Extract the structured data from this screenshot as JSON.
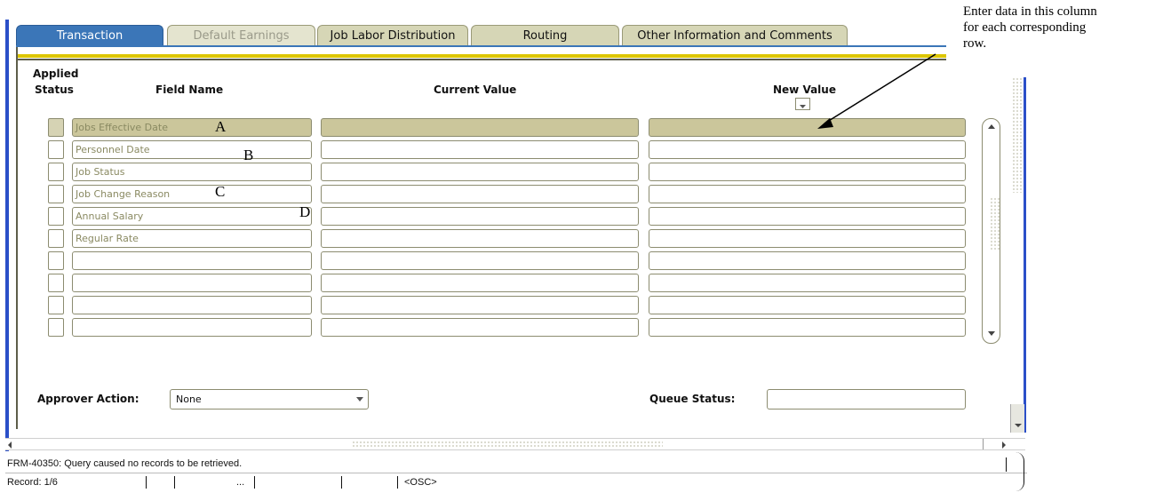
{
  "tabs": [
    {
      "label": "Transaction",
      "state": "active"
    },
    {
      "label": "Default Earnings",
      "state": "disabled"
    },
    {
      "label": "Job Labor Distribution",
      "state": "normal"
    },
    {
      "label": "Routing",
      "state": "normal"
    },
    {
      "label": "Other Information and Comments",
      "state": "normal"
    }
  ],
  "headers": {
    "applied_status_line1": "Applied",
    "applied_status_line2": "Status",
    "field_name": "Field Name",
    "current_value": "Current Value",
    "new_value": "New Value"
  },
  "rows": [
    {
      "field": "Jobs Effective Date",
      "current": "",
      "new": ""
    },
    {
      "field": "Personnel Date",
      "current": "",
      "new": ""
    },
    {
      "field": "Job Status",
      "current": "",
      "new": ""
    },
    {
      "field": "Job Change Reason",
      "current": "",
      "new": ""
    },
    {
      "field": "Annual Salary",
      "current": "",
      "new": ""
    },
    {
      "field": "Regular Rate",
      "current": "",
      "new": ""
    },
    {
      "field": "",
      "current": "",
      "new": ""
    },
    {
      "field": "",
      "current": "",
      "new": ""
    },
    {
      "field": "",
      "current": "",
      "new": ""
    },
    {
      "field": "",
      "current": "",
      "new": ""
    }
  ],
  "annotations": {
    "a": "A",
    "b": "B",
    "c": "C",
    "d": "D"
  },
  "note": {
    "line1": "Enter data  in this column",
    "line2": "for each corresponding",
    "line3": "row."
  },
  "approver": {
    "label": "Approver Action:",
    "value": "None"
  },
  "queue": {
    "label": "Queue Status:",
    "value": ""
  },
  "status_bar": {
    "message": "FRM-40350: Query caused no records to be retrieved.",
    "record": "Record: 1/6",
    "ellipsis": "...",
    "osc": "<OSC>"
  },
  "colors": {
    "accent": "#3b76b8",
    "highlight_row": "#cbc69b",
    "gold_bar": "#ddc600",
    "frame_blue": "#2b4fc8"
  }
}
